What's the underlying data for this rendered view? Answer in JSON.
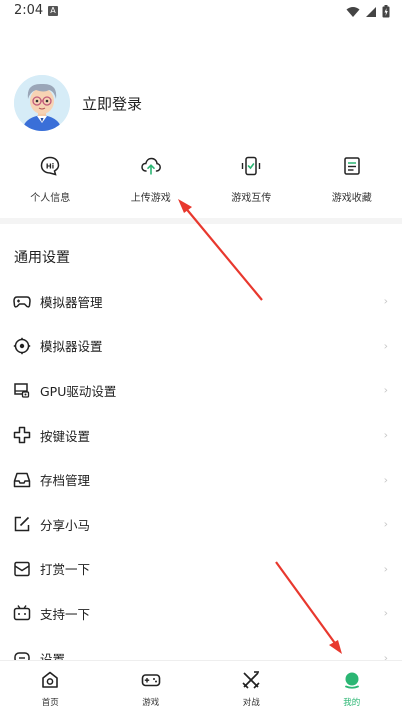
{
  "status_bar": {
    "time": "2:04",
    "notif_badge": "A"
  },
  "profile": {
    "login_label": "立即登录"
  },
  "quick_actions": [
    {
      "label": "个人信息",
      "icon": "hi-chat-icon"
    },
    {
      "label": "上传游戏",
      "icon": "cloud-upload-icon"
    },
    {
      "label": "游戏互传",
      "icon": "phone-transfer-icon"
    },
    {
      "label": "游戏收藏",
      "icon": "document-list-icon"
    }
  ],
  "settings": {
    "section_title": "通用设置",
    "items": [
      {
        "label": "模拟器管理",
        "icon": "gamepad-icon"
      },
      {
        "label": "模拟器设置",
        "icon": "gear-circle-icon"
      },
      {
        "label": "GPU驱动设置",
        "icon": "gpu-card-icon"
      },
      {
        "label": "按键设置",
        "icon": "dpad-icon"
      },
      {
        "label": "存档管理",
        "icon": "inbox-icon"
      },
      {
        "label": "分享小马",
        "icon": "share-edit-icon"
      },
      {
        "label": "打赏一下",
        "icon": "envelope-icon"
      },
      {
        "label": "支持一下",
        "icon": "tv-icon"
      },
      {
        "label": "设置",
        "icon": "settings-icon"
      }
    ],
    "chevron": "›"
  },
  "bottom_nav": [
    {
      "label": "首页",
      "icon": "home-camera-icon"
    },
    {
      "label": "游戏",
      "icon": "controller-icon"
    },
    {
      "label": "对战",
      "icon": "versus-icon"
    },
    {
      "label": "我的",
      "icon": "profile-dot-icon"
    }
  ],
  "colors": {
    "accent": "#2bb673",
    "arrow": "#e8382e"
  }
}
